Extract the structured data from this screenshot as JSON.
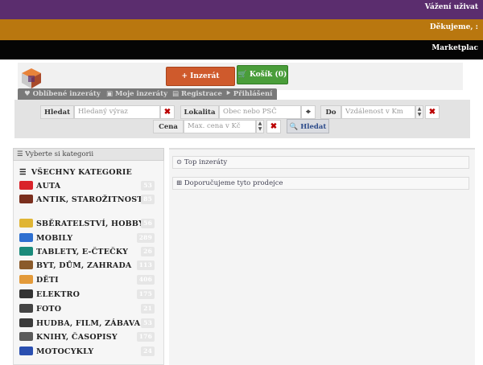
{
  "banners": {
    "welcome": "Vážení uživat",
    "thanks": "Děkujeme, :",
    "marketplace": "Marketplac"
  },
  "header": {
    "add_listing": "+ Inzerát",
    "cart": "Košík (0)",
    "user_menu": [
      "Oblíbené inzeráty",
      "Moje inzeráty",
      "Registrace",
      "Přihlášení"
    ]
  },
  "search": {
    "search_label": "Hledat",
    "search_placeholder": "Hledaný výraz",
    "location_label": "Lokalita",
    "location_placeholder": "Obec nebo PSČ",
    "to_label": "Do",
    "distance_placeholder": "Vzdálenost v Km",
    "price_label": "Cena",
    "price_placeholder": "Max. cena v Kč",
    "submit": "Hledat"
  },
  "sidebar": {
    "heading": "Vyberte si kategorii",
    "all": "VŠECHNY KATEGORIE",
    "categories": [
      {
        "label": "AUTA",
        "count": "53",
        "icon": "car-icon",
        "color": "#d9232a"
      },
      {
        "label": "ANTIK, STAROŽITNOSTI",
        "count": "85",
        "icon": "antique-icon",
        "color": "#7a2f1e"
      },
      {
        "label": "SBĚRATELSTVÍ, HOBBY",
        "count": "56",
        "icon": "collector-icon",
        "color": "#e0b534"
      },
      {
        "label": "MOBILY",
        "count": "289",
        "icon": "phone-icon",
        "color": "#2e6fd0"
      },
      {
        "label": "TABLETY, E-ČTEČKY",
        "count": "26",
        "icon": "tablet-icon",
        "color": "#1a8a7a"
      },
      {
        "label": "BYT, DŮM, ZAHRADA",
        "count": "113",
        "icon": "house-icon",
        "color": "#8a5a2b"
      },
      {
        "label": "DĚTI",
        "count": "406",
        "icon": "children-icon",
        "color": "#e39a3a"
      },
      {
        "label": "ELEKTRO",
        "count": "175",
        "icon": "electro-icon",
        "color": "#333333"
      },
      {
        "label": "FOTO",
        "count": "21",
        "icon": "camera-icon",
        "color": "#444444"
      },
      {
        "label": "HUDBA, FILM, ZÁBAVA",
        "count": "53",
        "icon": "music-icon",
        "color": "#3b3b3b"
      },
      {
        "label": "KNIHY, ČASOPISY",
        "count": "176",
        "icon": "book-icon",
        "color": "#5a5a5a"
      },
      {
        "label": "MOTOCYKLY",
        "count": "24",
        "icon": "motorcycle-icon",
        "color": "#2a4fb0"
      }
    ]
  },
  "main": {
    "top_listings": "Top inzeráty",
    "recommended_sellers": "Doporučujeme tyto prodejce"
  }
}
